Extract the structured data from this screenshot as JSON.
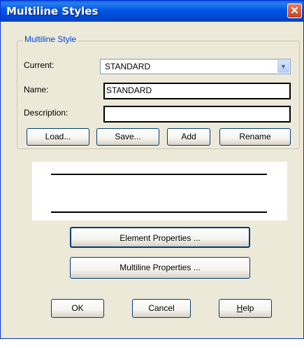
{
  "window": {
    "title": "Multiline Styles",
    "close_glyph": "✕"
  },
  "multiline_style": {
    "group_label": "Multiline Style",
    "current_label": "Current:",
    "current_value": "STANDARD",
    "name_label": "Name:",
    "name_value": "STANDARD",
    "description_label": "Description:",
    "description_value": "",
    "buttons": {
      "load": "Load...",
      "save": "Save...",
      "add": "Add",
      "rename": "Rename"
    }
  },
  "properties": {
    "element": "Element Properties ...",
    "multiline": "Multiline Properties ..."
  },
  "footer": {
    "ok": "OK",
    "cancel": "Cancel",
    "help_mnemonic": "H",
    "help_rest": "elp"
  },
  "icons": {
    "dropdown": "chevron-down-icon",
    "close": "close-icon"
  },
  "colors": {
    "titlebar": "#0055e5",
    "dialog_bg": "#ece9d8",
    "group_label": "#0046d5",
    "close_button": "#c6421c",
    "button_border": "#003c74"
  }
}
